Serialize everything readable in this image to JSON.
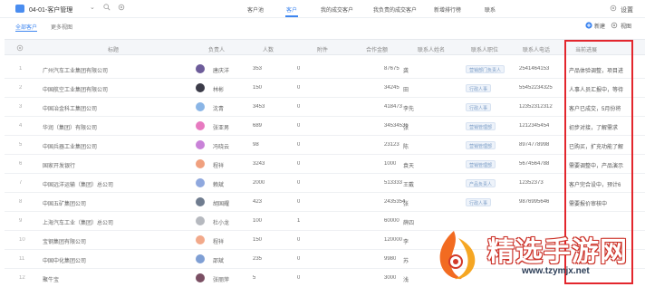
{
  "topbar": {
    "title": "04-01-客户管理",
    "nav": [
      "客户池",
      "客户",
      "我的成交客户",
      "我负责的成交客户",
      "新增排行榜",
      "联系"
    ],
    "settings_label": "设置"
  },
  "subbar": {
    "tabs": [
      "全部客户",
      "更多视图"
    ],
    "new_label": "新建",
    "view_label": "视图"
  },
  "table": {
    "headers": [
      "标题",
      "负责人",
      "人数",
      "附件",
      "合作金额",
      "联系人姓名",
      "联系人职位",
      "联系人电话",
      "当前进展"
    ],
    "rows": [
      {
        "idx": "1",
        "title": "广州汽车工业集团有限公司",
        "owner": "唐庆洋",
        "people": "353",
        "attach": "0",
        "amount": "87675",
        "contact": "龚",
        "position": "营销部门负责人",
        "phone": "2541464153",
        "progress": "产品体验调整，项目进"
      },
      {
        "idx": "2",
        "title": "中国航空工业集团有限公司",
        "owner": "林彬",
        "people": "150",
        "attach": "0",
        "amount": "34245",
        "contact": "田",
        "position": "行政人事",
        "phone": "55452234325",
        "progress": "人事人员汇报中，等待"
      },
      {
        "idx": "3",
        "title": "中国冶金科工集团公司",
        "owner": "沈青",
        "people": "3453",
        "attach": "0",
        "amount": "418473",
        "contact": "李先",
        "position": "行政人事",
        "phone": "12352312312",
        "progress": "客户已成交，5月份将"
      },
      {
        "idx": "4",
        "title": "华润（集团）有限公司",
        "owner": "张亚男",
        "people": "689",
        "attach": "0",
        "amount": "34534536",
        "contact": "张",
        "position": "营销管理部",
        "phone": "1212345454",
        "progress": "初步对接，了解需求"
      },
      {
        "idx": "5",
        "title": "中国兵器工业集团公司",
        "owner": "冯晓云",
        "people": "98",
        "attach": "0",
        "amount": "23123",
        "contact": "陈",
        "position": "营销管理部",
        "phone": "8974778998",
        "progress": "已购买，扩充功能了解"
      },
      {
        "idx": "6",
        "title": "国家开发银行",
        "owner": "程祥",
        "people": "3243",
        "attach": "0",
        "amount": "1000",
        "contact": "袁天",
        "position": "营销管理部",
        "phone": "5674564788",
        "progress": "需要调整中，产品演示"
      },
      {
        "idx": "7",
        "title": "中国远洋运输（集团）总公司",
        "owner": "赖斌",
        "people": "2000",
        "attach": "0",
        "amount": "513333",
        "contact": "王戴",
        "position": "产品负责人",
        "phone": "12352373",
        "progress": "客户完合设中，预计6"
      },
      {
        "idx": "8",
        "title": "中国五矿集团公司",
        "owner": "胡国耀",
        "people": "423",
        "attach": "0",
        "amount": "2435354",
        "contact": "张",
        "position": "行政人事",
        "phone": "9876995646",
        "progress": "需要报价审核中"
      },
      {
        "idx": "9",
        "title": "上海汽车工业（集团）总公司",
        "owner": "杜小龙",
        "people": "100",
        "attach": "1",
        "amount": "60000",
        "contact": "薛四",
        "position": "",
        "phone": "",
        "progress": ""
      },
      {
        "idx": "10",
        "title": "宝钢集团有限公司",
        "owner": "程祥",
        "people": "150",
        "attach": "0",
        "amount": "120000",
        "contact": "李",
        "position": "",
        "phone": "",
        "progress": ""
      },
      {
        "idx": "11",
        "title": "中国中化集团公司",
        "owner": "邵斌",
        "people": "235",
        "attach": "0",
        "amount": "9980",
        "contact": "苏",
        "position": "",
        "phone": "",
        "progress": ""
      },
      {
        "idx": "12",
        "title": "聚牛宝",
        "owner": "张丽萍",
        "people": "5",
        "attach": "0",
        "amount": "3000",
        "contact": "浅",
        "position": "",
        "phone": "",
        "progress": ""
      }
    ],
    "avatar_colors": [
      "#6d5c9a",
      "#3b3b48",
      "#8ab5e6",
      "#e77ac0",
      "#c982d8",
      "#f0a07e",
      "#8fa8de",
      "#6f7c8f",
      "#b6b9bf",
      "#f2a98a",
      "#7f9fd4",
      "#7a4f63"
    ]
  },
  "watermark": {
    "brand": "精选手游网",
    "url": "www.tzymjx.net"
  },
  "colors": {
    "accent": "#3e86f0",
    "highlight_box": "#e3262d"
  }
}
